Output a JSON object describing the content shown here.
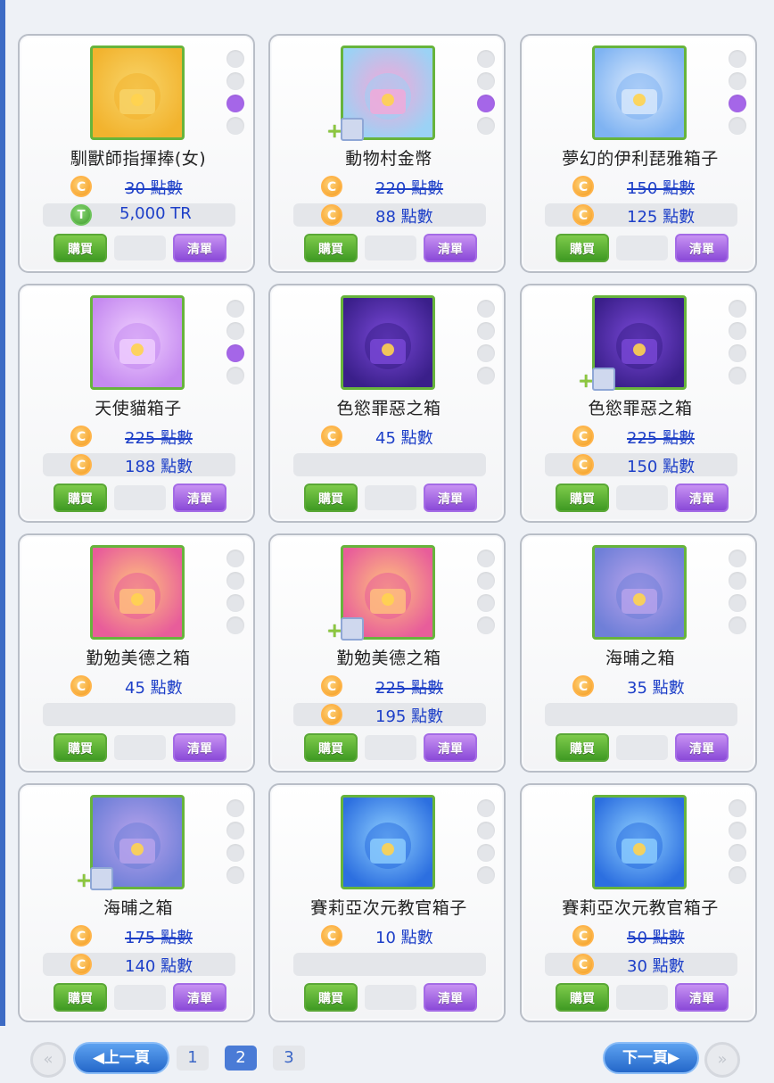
{
  "products": [
    {
      "name": "馴獸師指揮捧(女)",
      "price1": {
        "coin": "C",
        "text": "30 點數",
        "strike": true,
        "bg": false
      },
      "price2": {
        "coin": "T",
        "text": "5,000 TR",
        "strike": false,
        "bg": true
      },
      "buy_label": "購買",
      "list_label": "清單",
      "dots": [
        false,
        false,
        true,
        false
      ],
      "bundle": false,
      "icon": "conductor-baton-icon",
      "colors": [
        "#f2b32e",
        "#f8d56a"
      ]
    },
    {
      "name": "動物村金幣",
      "price1": {
        "coin": "C",
        "text": "220 點數",
        "strike": true,
        "bg": false
      },
      "price2": {
        "coin": "C",
        "text": "88 點數",
        "strike": false,
        "bg": true
      },
      "buy_label": "購買",
      "list_label": "清單",
      "dots": [
        false,
        false,
        true,
        false
      ],
      "bundle": true,
      "icon": "gold-coin-icon",
      "colors": [
        "#9bd2f5",
        "#f5a7d8"
      ]
    },
    {
      "name": "夢幻的伊利琵雅箱子",
      "price1": {
        "coin": "C",
        "text": "150 點數",
        "strike": true,
        "bg": false
      },
      "price2": {
        "coin": "C",
        "text": "125 點數",
        "strike": false,
        "bg": true
      },
      "buy_label": "購買",
      "list_label": "清單",
      "dots": [
        false,
        false,
        true,
        false
      ],
      "bundle": false,
      "icon": "crystal-box-icon",
      "colors": [
        "#7fb3f2",
        "#dbeafd"
      ]
    },
    {
      "name": "天使貓箱子",
      "price1": {
        "coin": "C",
        "text": "225 點數",
        "strike": true,
        "bg": false
      },
      "price2": {
        "coin": "C",
        "text": "188 點數",
        "strike": false,
        "bg": true
      },
      "buy_label": "購買",
      "list_label": "清單",
      "dots": [
        false,
        false,
        true,
        false
      ],
      "bundle": false,
      "icon": "angel-cat-bag-icon",
      "colors": [
        "#c58af0",
        "#f0d0ff"
      ]
    },
    {
      "name": "色慾罪惡之箱",
      "price1": {
        "coin": "C",
        "text": "45 點數",
        "strike": false,
        "bg": false
      },
      "price2": {
        "coin": "",
        "text": "",
        "strike": false,
        "bg": true
      },
      "buy_label": "購買",
      "list_label": "清單",
      "dots": [
        false,
        false,
        false,
        false
      ],
      "bundle": false,
      "icon": "lust-sin-box-icon",
      "colors": [
        "#3a1f8a",
        "#7a49d8"
      ]
    },
    {
      "name": "色慾罪惡之箱",
      "price1": {
        "coin": "C",
        "text": "225 點數",
        "strike": true,
        "bg": false
      },
      "price2": {
        "coin": "C",
        "text": "150 點數",
        "strike": false,
        "bg": true
      },
      "buy_label": "購買",
      "list_label": "清單",
      "dots": [
        false,
        false,
        false,
        false
      ],
      "bundle": true,
      "icon": "lust-sin-box-icon",
      "colors": [
        "#3a1f8a",
        "#7a49d8"
      ]
    },
    {
      "name": "勤勉美德之箱",
      "price1": {
        "coin": "C",
        "text": "45 點數",
        "strike": false,
        "bg": false
      },
      "price2": {
        "coin": "",
        "text": "",
        "strike": false,
        "bg": true
      },
      "buy_label": "購買",
      "list_label": "清單",
      "dots": [
        false,
        false,
        false,
        false
      ],
      "bundle": false,
      "icon": "diligence-virtue-box-icon",
      "colors": [
        "#e85d9a",
        "#ffc27d"
      ]
    },
    {
      "name": "勤勉美德之箱",
      "price1": {
        "coin": "C",
        "text": "225 點數",
        "strike": true,
        "bg": false
      },
      "price2": {
        "coin": "C",
        "text": "195 點數",
        "strike": false,
        "bg": true
      },
      "buy_label": "購買",
      "list_label": "清單",
      "dots": [
        false,
        false,
        false,
        false
      ],
      "bundle": true,
      "icon": "diligence-virtue-box-icon",
      "colors": [
        "#e85d9a",
        "#ffc27d"
      ]
    },
    {
      "name": "海晡之箱",
      "price1": {
        "coin": "C",
        "text": "35 點數",
        "strike": false,
        "bg": false
      },
      "price2": {
        "coin": "",
        "text": "",
        "strike": false,
        "bg": true
      },
      "buy_label": "購買",
      "list_label": "清單",
      "dots": [
        false,
        false,
        false,
        false
      ],
      "bundle": false,
      "icon": "sea-chest-icon",
      "colors": [
        "#6f7fd8",
        "#b9a4ec"
      ]
    },
    {
      "name": "海晡之箱",
      "price1": {
        "coin": "C",
        "text": "175 點數",
        "strike": true,
        "bg": false
      },
      "price2": {
        "coin": "C",
        "text": "140 點數",
        "strike": false,
        "bg": true
      },
      "buy_label": "購買",
      "list_label": "清單",
      "dots": [
        false,
        false,
        false,
        false
      ],
      "bundle": true,
      "icon": "sea-chest-icon",
      "colors": [
        "#6f7fd8",
        "#b9a4ec"
      ]
    },
    {
      "name": "賽莉亞次元教官箱子",
      "price1": {
        "coin": "C",
        "text": "10 點數",
        "strike": false,
        "bg": false
      },
      "price2": {
        "coin": "",
        "text": "",
        "strike": false,
        "bg": true
      },
      "buy_label": "購買",
      "list_label": "清單",
      "dots": [
        false,
        false,
        false,
        false
      ],
      "bundle": false,
      "icon": "seria-dimension-box-icon",
      "colors": [
        "#2c6fe0",
        "#8fd0ff"
      ]
    },
    {
      "name": "賽莉亞次元教官箱子",
      "price1": {
        "coin": "C",
        "text": "50 點數",
        "strike": true,
        "bg": false
      },
      "price2": {
        "coin": "C",
        "text": "30 點數",
        "strike": false,
        "bg": true
      },
      "buy_label": "購買",
      "list_label": "清單",
      "dots": [
        false,
        false,
        false,
        false
      ],
      "bundle": false,
      "icon": "seria-dimension-box-icon",
      "colors": [
        "#2c6fe0",
        "#8fd0ff"
      ]
    }
  ],
  "pager": {
    "first_icon": "first-page-icon",
    "prev_label": "◀上一頁",
    "pages": [
      "1",
      "2",
      "3"
    ],
    "current_page": "2",
    "next_label": "下一頁▶",
    "last_icon": "last-page-icon"
  }
}
